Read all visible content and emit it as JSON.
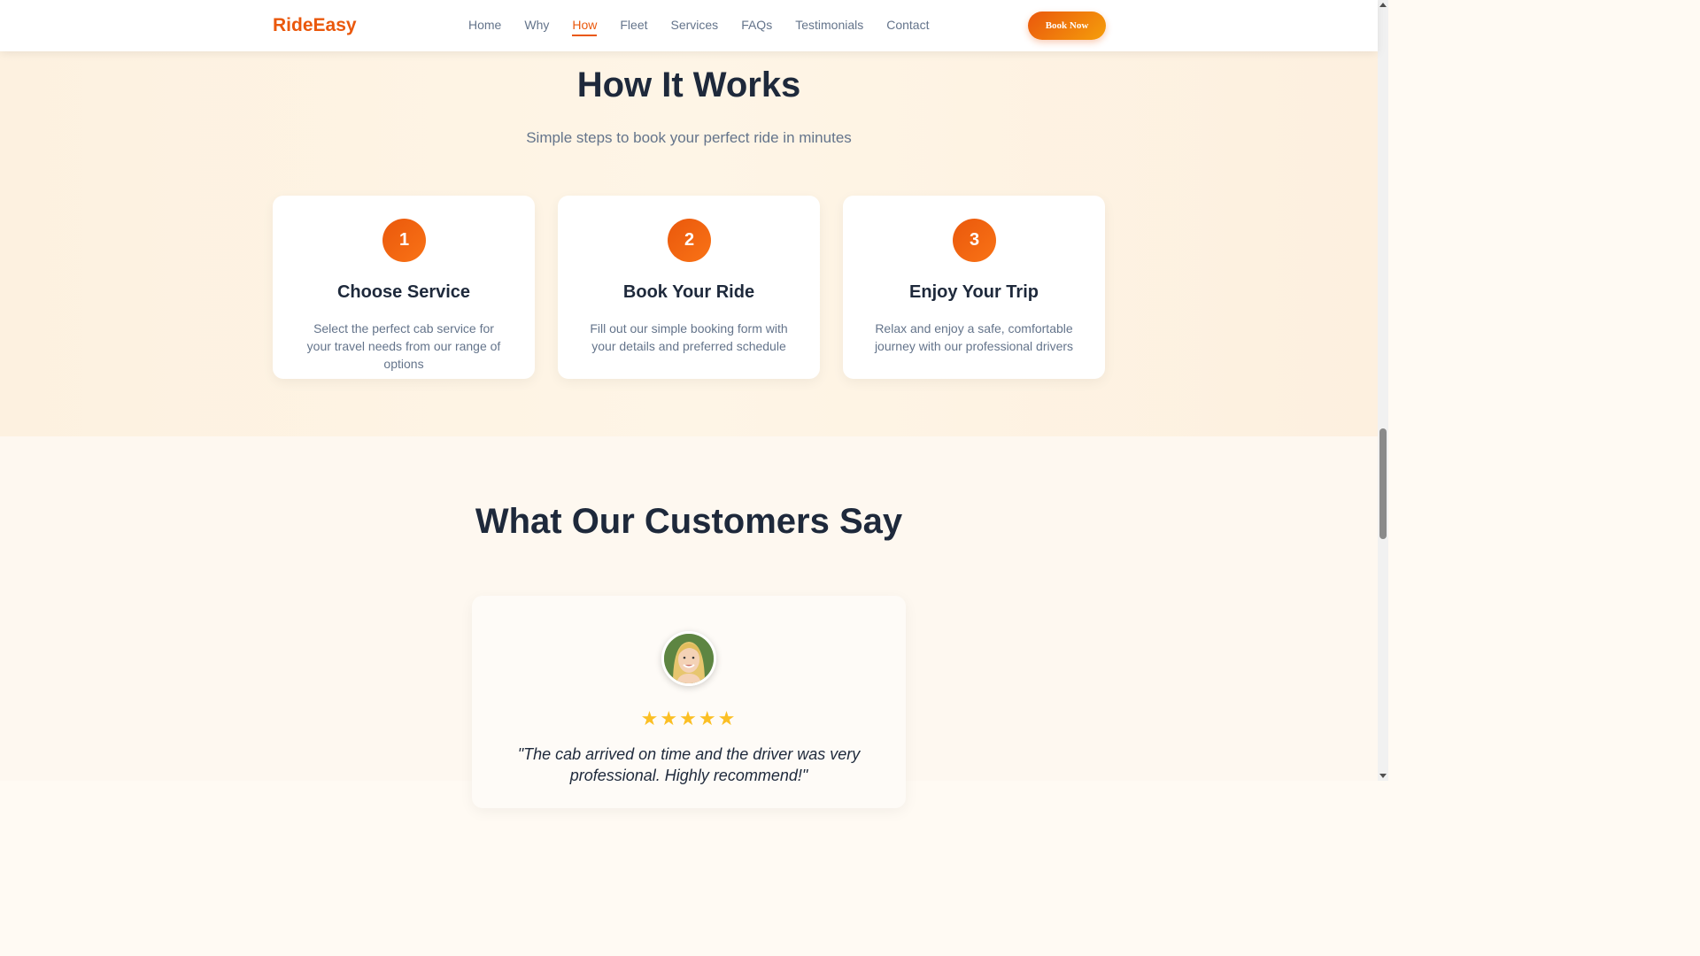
{
  "nav": {
    "brand": "RideEasy",
    "links": [
      "Home",
      "Why",
      "How",
      "Fleet",
      "Services",
      "FAQs",
      "Testimonials",
      "Contact"
    ],
    "active": "How",
    "cta": "Book Now"
  },
  "how": {
    "title": "How It Works",
    "subtitle": "Simple steps to book your perfect ride in minutes",
    "steps": [
      {
        "number": "1",
        "title": "Choose Service",
        "desc": "Select the perfect cab service for your travel needs from our range of options"
      },
      {
        "number": "2",
        "title": "Book Your Ride",
        "desc": "Fill out our simple booking form with your details and preferred schedule"
      },
      {
        "number": "3",
        "title": "Enjoy Your Trip",
        "desc": "Relax and enjoy a safe, comfortable journey with our professional drivers"
      }
    ]
  },
  "testimonials": {
    "title": "What Our Customers Say",
    "rating": 5,
    "quote": "\"The cab arrived on time and the driver was very professional. Highly recommend!\""
  },
  "colors": {
    "accent": "#ea580c",
    "accent_light": "#f59e0b",
    "star": "#fbbf24",
    "heading": "#1e293b",
    "muted": "#64748b"
  },
  "icons": {
    "star": "star-icon",
    "avatar": "customer-avatar"
  }
}
